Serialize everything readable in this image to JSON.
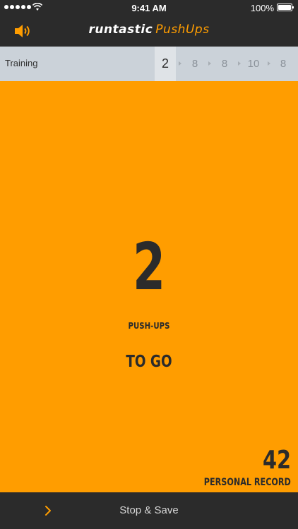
{
  "status_bar": {
    "time": "9:41 AM",
    "battery_percent": "100%",
    "signal_bars": 5,
    "icons": [
      "signal-dots-icon",
      "wifi-icon",
      "battery-icon"
    ]
  },
  "nav": {
    "brand": "runtastic",
    "app_name": "PushUps",
    "sound_icon": "speaker-icon"
  },
  "training": {
    "label": "Training",
    "sets": [
      "2",
      "8",
      "8",
      "10",
      "8"
    ],
    "active_index": 0
  },
  "counter": {
    "remaining": "2",
    "unit_label": "PUSH-UPS",
    "status": "TO GO"
  },
  "record": {
    "value": "42",
    "label": "PERSONAL RECORD"
  },
  "bottom_bar": {
    "action_label": "Stop & Save",
    "expand_icon": "chevron-right-icon"
  },
  "colors": {
    "accent": "#ff9d00",
    "dark_bar": "#2b2b2b",
    "strip": "#cbd2d9",
    "text_dark": "#2b2b2b"
  }
}
